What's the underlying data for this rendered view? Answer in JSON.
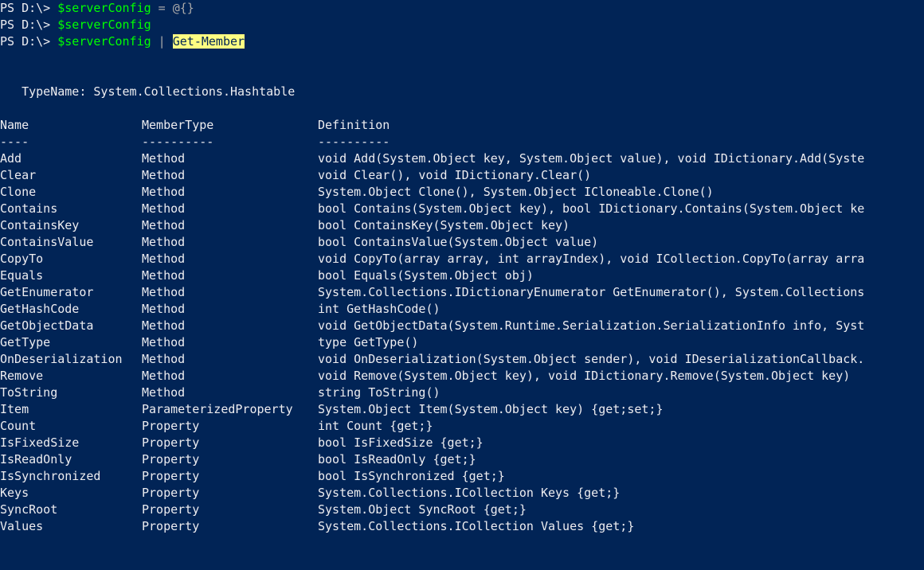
{
  "lines": [
    {
      "prompt": "PS D:\\> ",
      "var": "$serverConfig",
      "rest_parts": [
        {
          "t": " = ",
          "c": "operator"
        },
        {
          "t": "@{}",
          "c": "operator"
        }
      ]
    },
    {
      "prompt": "PS D:\\> ",
      "var": "$serverConfig",
      "rest_parts": []
    },
    {
      "prompt": "PS D:\\> ",
      "var": "$serverConfig",
      "rest_parts": [
        {
          "t": " | ",
          "c": "operator"
        },
        {
          "t": "Get-Member",
          "c": "highlight"
        }
      ]
    }
  ],
  "typename_label": "   TypeName: ",
  "typename_value": "System.Collections.Hashtable",
  "headers": {
    "name": "Name",
    "type": "MemberType",
    "def": "Definition"
  },
  "underlines": {
    "name": "----",
    "type": "----------",
    "def": "----------"
  },
  "members": [
    {
      "name": "Add",
      "type": "Method",
      "def": "void Add(System.Object key, System.Object value), void IDictionary.Add(Syste"
    },
    {
      "name": "Clear",
      "type": "Method",
      "def": "void Clear(), void IDictionary.Clear()"
    },
    {
      "name": "Clone",
      "type": "Method",
      "def": "System.Object Clone(), System.Object ICloneable.Clone()"
    },
    {
      "name": "Contains",
      "type": "Method",
      "def": "bool Contains(System.Object key), bool IDictionary.Contains(System.Object ke"
    },
    {
      "name": "ContainsKey",
      "type": "Method",
      "def": "bool ContainsKey(System.Object key)"
    },
    {
      "name": "ContainsValue",
      "type": "Method",
      "def": "bool ContainsValue(System.Object value)"
    },
    {
      "name": "CopyTo",
      "type": "Method",
      "def": "void CopyTo(array array, int arrayIndex), void ICollection.CopyTo(array arra"
    },
    {
      "name": "Equals",
      "type": "Method",
      "def": "bool Equals(System.Object obj)"
    },
    {
      "name": "GetEnumerator",
      "type": "Method",
      "def": "System.Collections.IDictionaryEnumerator GetEnumerator(), System.Collections"
    },
    {
      "name": "GetHashCode",
      "type": "Method",
      "def": "int GetHashCode()"
    },
    {
      "name": "GetObjectData",
      "type": "Method",
      "def": "void GetObjectData(System.Runtime.Serialization.SerializationInfo info, Syst"
    },
    {
      "name": "GetType",
      "type": "Method",
      "def": "type GetType()"
    },
    {
      "name": "OnDeserialization",
      "type": "Method",
      "def": "void OnDeserialization(System.Object sender), void IDeserializationCallback."
    },
    {
      "name": "Remove",
      "type": "Method",
      "def": "void Remove(System.Object key), void IDictionary.Remove(System.Object key)"
    },
    {
      "name": "ToString",
      "type": "Method",
      "def": "string ToString()"
    },
    {
      "name": "Item",
      "type": "ParameterizedProperty",
      "def": "System.Object Item(System.Object key) {get;set;}"
    },
    {
      "name": "Count",
      "type": "Property",
      "def": "int Count {get;}"
    },
    {
      "name": "IsFixedSize",
      "type": "Property",
      "def": "bool IsFixedSize {get;}"
    },
    {
      "name": "IsReadOnly",
      "type": "Property",
      "def": "bool IsReadOnly {get;}"
    },
    {
      "name": "IsSynchronized",
      "type": "Property",
      "def": "bool IsSynchronized {get;}"
    },
    {
      "name": "Keys",
      "type": "Property",
      "def": "System.Collections.ICollection Keys {get;}"
    },
    {
      "name": "SyncRoot",
      "type": "Property",
      "def": "System.Object SyncRoot {get;}"
    },
    {
      "name": "Values",
      "type": "Property",
      "def": "System.Collections.ICollection Values {get;}"
    }
  ]
}
